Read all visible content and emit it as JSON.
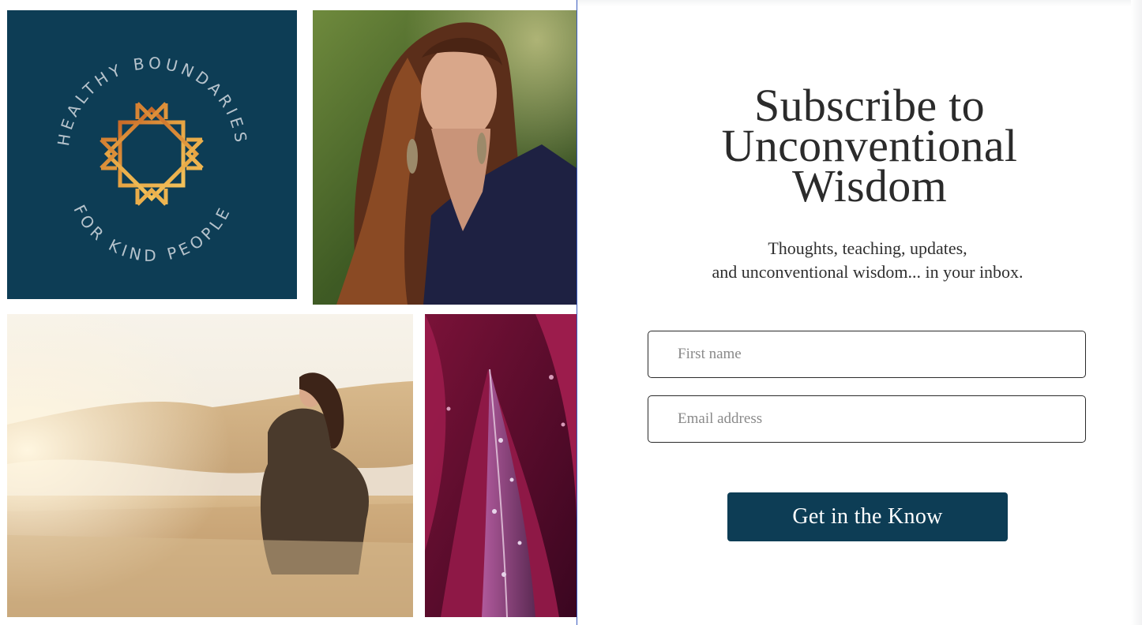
{
  "collage": {
    "logo": {
      "arc_top": "HEALTHY BOUNDARIES",
      "arc_bottom": "FOR KIND PEOPLE",
      "background": "#0d3d55",
      "mark_color": "#d9963a",
      "text_color": "#b6c3cc"
    }
  },
  "signup": {
    "headline_lines": [
      "Subscribe to",
      "Unconventional",
      "Wisdom"
    ],
    "subtext_lines": [
      "Thoughts, teaching, updates,",
      "and unconventional wisdom... in your inbox."
    ],
    "first_name_placeholder": "First name",
    "email_placeholder": "Email address",
    "submit_label": "Get in the Know",
    "accent_color": "#0d3d55"
  }
}
